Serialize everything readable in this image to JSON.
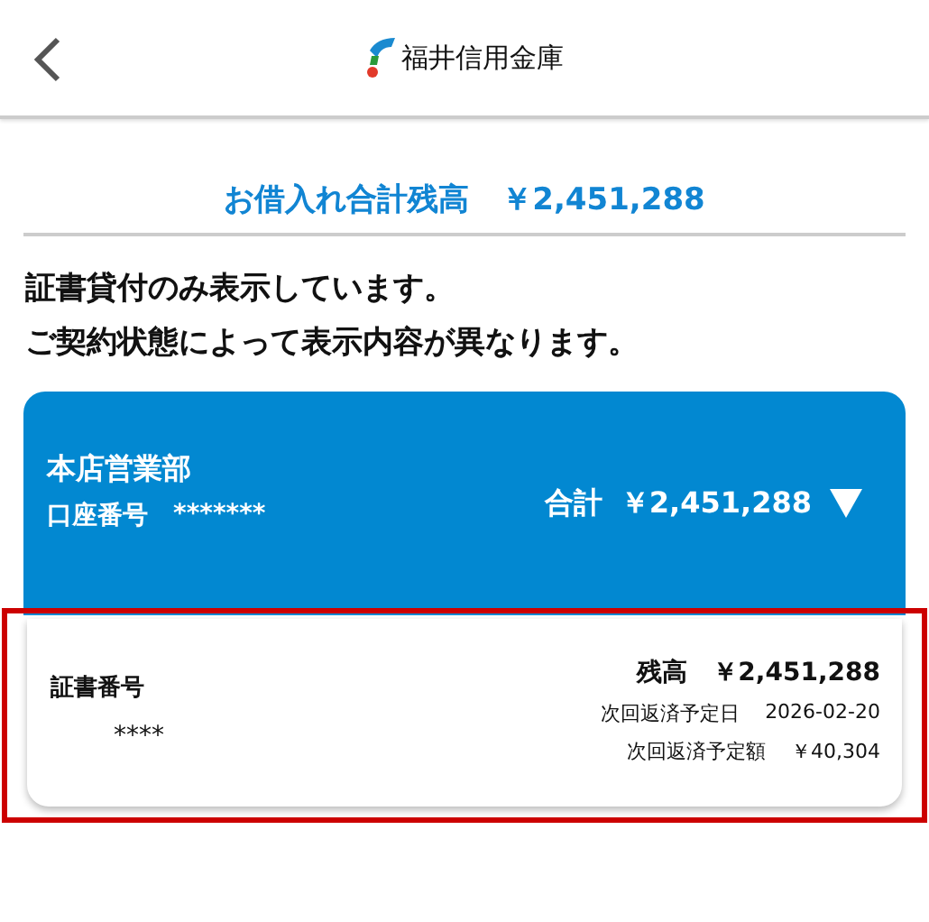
{
  "header": {
    "title": "福井信用金庫"
  },
  "summary": {
    "label": "お借入れ合計残高",
    "amount": "￥2,451,288"
  },
  "notice": [
    "証書貸付のみ表示しています。",
    "ご契約状態によって表示内容が異なります。"
  ],
  "account": {
    "branch": "本店営業部",
    "number_label": "口座番号",
    "number": "*******",
    "total_label": "合計",
    "total": "￥2,451,288",
    "expanded": true,
    "loans": [
      {
        "id_label": "証書番号",
        "id": "****",
        "balance_label": "残高",
        "balance": "￥2,451,288",
        "due_date_label": "次回返済予定日",
        "due_date": "2026-02-20",
        "due_amount_label": "次回返済予定額",
        "due_amount": "￥40,304",
        "highlighted": true
      }
    ]
  }
}
